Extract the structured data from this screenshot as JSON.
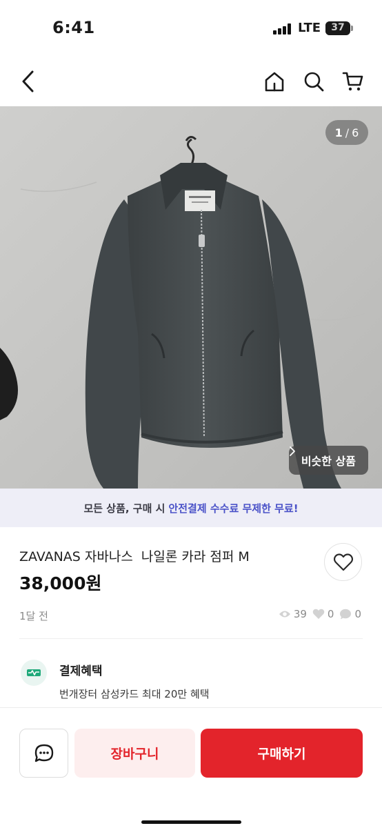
{
  "status_bar": {
    "time": "6:41",
    "network": "LTE",
    "battery": "37",
    "battery_level": 0.37
  },
  "nav": {
    "back_icon": "chevron-left-icon",
    "home_icon": "home-icon",
    "search_icon": "search-icon",
    "cart_icon": "cart-icon"
  },
  "photo": {
    "current": "1",
    "total": "6",
    "separator": "/",
    "similar_label": "비슷한 상품"
  },
  "promo": {
    "text": "모든 상품, 구매 시",
    "highlight": "안전결제 수수료 무제한 무료!",
    "highlight_color": "#4a52c8"
  },
  "product": {
    "title": "ZAVANAS 자바나스  나일론 카라 점퍼 M",
    "price": "38,000원",
    "posted": "1달 전",
    "views": "39",
    "likes": "0",
    "chats": "0"
  },
  "benefit": {
    "title": "결제혜택",
    "description": "번개장터 삼성카드 최대 20만 혜택"
  },
  "actions": {
    "cart_label": "장바구니",
    "buy_label": "구매하기",
    "accent": "#e3242b"
  }
}
